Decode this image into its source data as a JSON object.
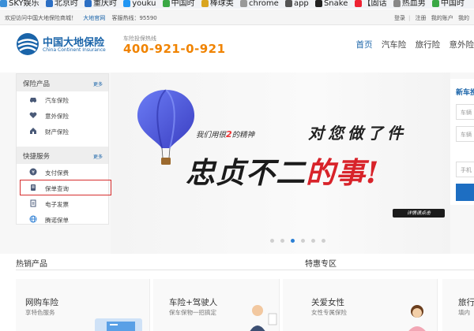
{
  "bookmarks": [
    "SKY娱乐",
    "北京时",
    "重庆时",
    "youku",
    "中国时",
    "棒球类",
    "chrome",
    "app",
    "Snake",
    "【固话",
    "热血男",
    "中国时"
  ],
  "topbar": {
    "welcome": "欢迎访问中国大地保险商城！",
    "official": "大地官网",
    "service": "客服热线：95590",
    "login": "登录",
    "register": "注册",
    "account": "我的账户",
    "mine": "我的"
  },
  "header": {
    "logo_cn": "中国大地保险",
    "logo_en": "China Continent Insurance",
    "hotline_label": "车险投保热线",
    "hotline": "400-921-0-921",
    "nav": [
      "首页",
      "汽车险",
      "旅行险",
      "意外险"
    ]
  },
  "sidebar": {
    "section1": {
      "title": "保险产品",
      "more": "更多",
      "items": [
        "汽车保险",
        "意外保险",
        "财产保险"
      ]
    },
    "section2": {
      "title": "快捷服务",
      "more": "更多",
      "items": [
        "支付保费",
        "保单查询",
        "电子发票",
        "腾诺保单"
      ]
    }
  },
  "hero": {
    "slogan_pre": "我们用很",
    "slogan_num": "2",
    "slogan_post": "的精神",
    "big1": "对您做了件",
    "big2a": "忠贞不二",
    "big2b": "的事!",
    "detail": "详情请点击",
    "dots": 6,
    "active_dot": 3
  },
  "form": {
    "title": "新车投",
    "field1": "车辆",
    "field2": "车辆",
    "field3": "手机"
  },
  "sections": {
    "hot": "热销产品",
    "special": "特惠专区"
  },
  "cards": [
    {
      "title": "网购车险",
      "sub": "享特色服务"
    },
    {
      "title": "车险+驾驶人",
      "sub": "保车保物一招搞定"
    },
    {
      "title": "关爱女性",
      "sub": "女性专属保险"
    },
    {
      "title": "旅行",
      "sub": "填内"
    }
  ],
  "colors": {
    "brand_blue": "#1a64a9",
    "hotline_orange": "#f08300",
    "highlight_red": "#d62e2e"
  }
}
